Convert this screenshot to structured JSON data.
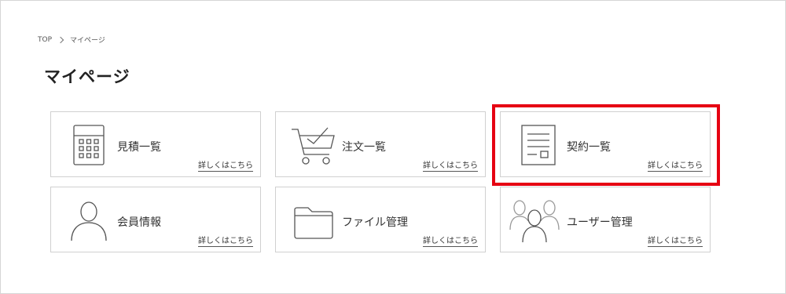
{
  "breadcrumb": {
    "home": "TOP",
    "current": "マイページ"
  },
  "page": {
    "title": "マイページ"
  },
  "more_label": "詳しくはこちら",
  "cards": [
    {
      "label": "見積一覧",
      "icon": "calculator-icon"
    },
    {
      "label": "注文一覧",
      "icon": "shopping-cart-check-icon"
    },
    {
      "label": "契約一覧",
      "icon": "document-icon"
    },
    {
      "label": "会員情報",
      "icon": "person-icon"
    },
    {
      "label": "ファイル管理",
      "icon": "folder-icon"
    },
    {
      "label": "ユーザー管理",
      "icon": "users-group-icon"
    }
  ],
  "colors": {
    "highlight": "#e60012",
    "border": "#d0d0d0",
    "icon": "#555555"
  }
}
